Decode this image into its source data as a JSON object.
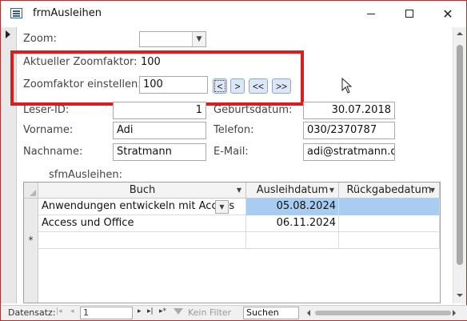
{
  "window": {
    "title": "frmAusleihen",
    "minimize_symbol": "—",
    "maximize_symbol": "☐",
    "close_symbol": "✕"
  },
  "form": {
    "zoom_label": "Zoom:",
    "zoom_value": "",
    "current_zoom_label": "Aktueller Zoomfaktor:",
    "current_zoom_value": "100",
    "set_zoom_label": "Zoomfaktor einstellen:",
    "set_zoom_value": "100",
    "nav_buttons": [
      "<",
      ">",
      "<<",
      ">>"
    ],
    "leser_id_label": "Leser-ID:",
    "leser_id_value": "1",
    "geburtsdatum_label": "Geburtsdatum:",
    "geburtsdatum_value": "30.07.2018",
    "vorname_label": "Vorname:",
    "vorname_value": "Adi",
    "telefon_label": "Telefon:",
    "telefon_value": "030/2370787",
    "nachname_label": "Nachname:",
    "nachname_value": "Stratmann",
    "email_label": "E-Mail:",
    "email_value": "adi@stratmann.de"
  },
  "subform": {
    "label": "sfmAusleihen:",
    "columns": [
      "Buch",
      "Ausleihdatum",
      "Rückgabedatum"
    ],
    "rows": [
      {
        "buch": "Anwendungen entwickeln mit Access",
        "ausleihdatum": "05.08.2024",
        "rueckgabedatum": ""
      },
      {
        "buch": "Access und Office",
        "ausleihdatum": "06.11.2024",
        "rueckgabedatum": ""
      }
    ],
    "new_row_marker": "*"
  },
  "navbar": {
    "label": "Datensatz:",
    "first": "|◂",
    "prev": "◂",
    "record": "1",
    "next": "▸",
    "last": "▸|",
    "new": "▸*",
    "filter_label": "Kein Filter",
    "search_placeholder": "Suchen"
  },
  "colors": {
    "highlight": "#e01b1b",
    "selection": "#a9cdf0",
    "button_bg": "#dce6f4"
  }
}
